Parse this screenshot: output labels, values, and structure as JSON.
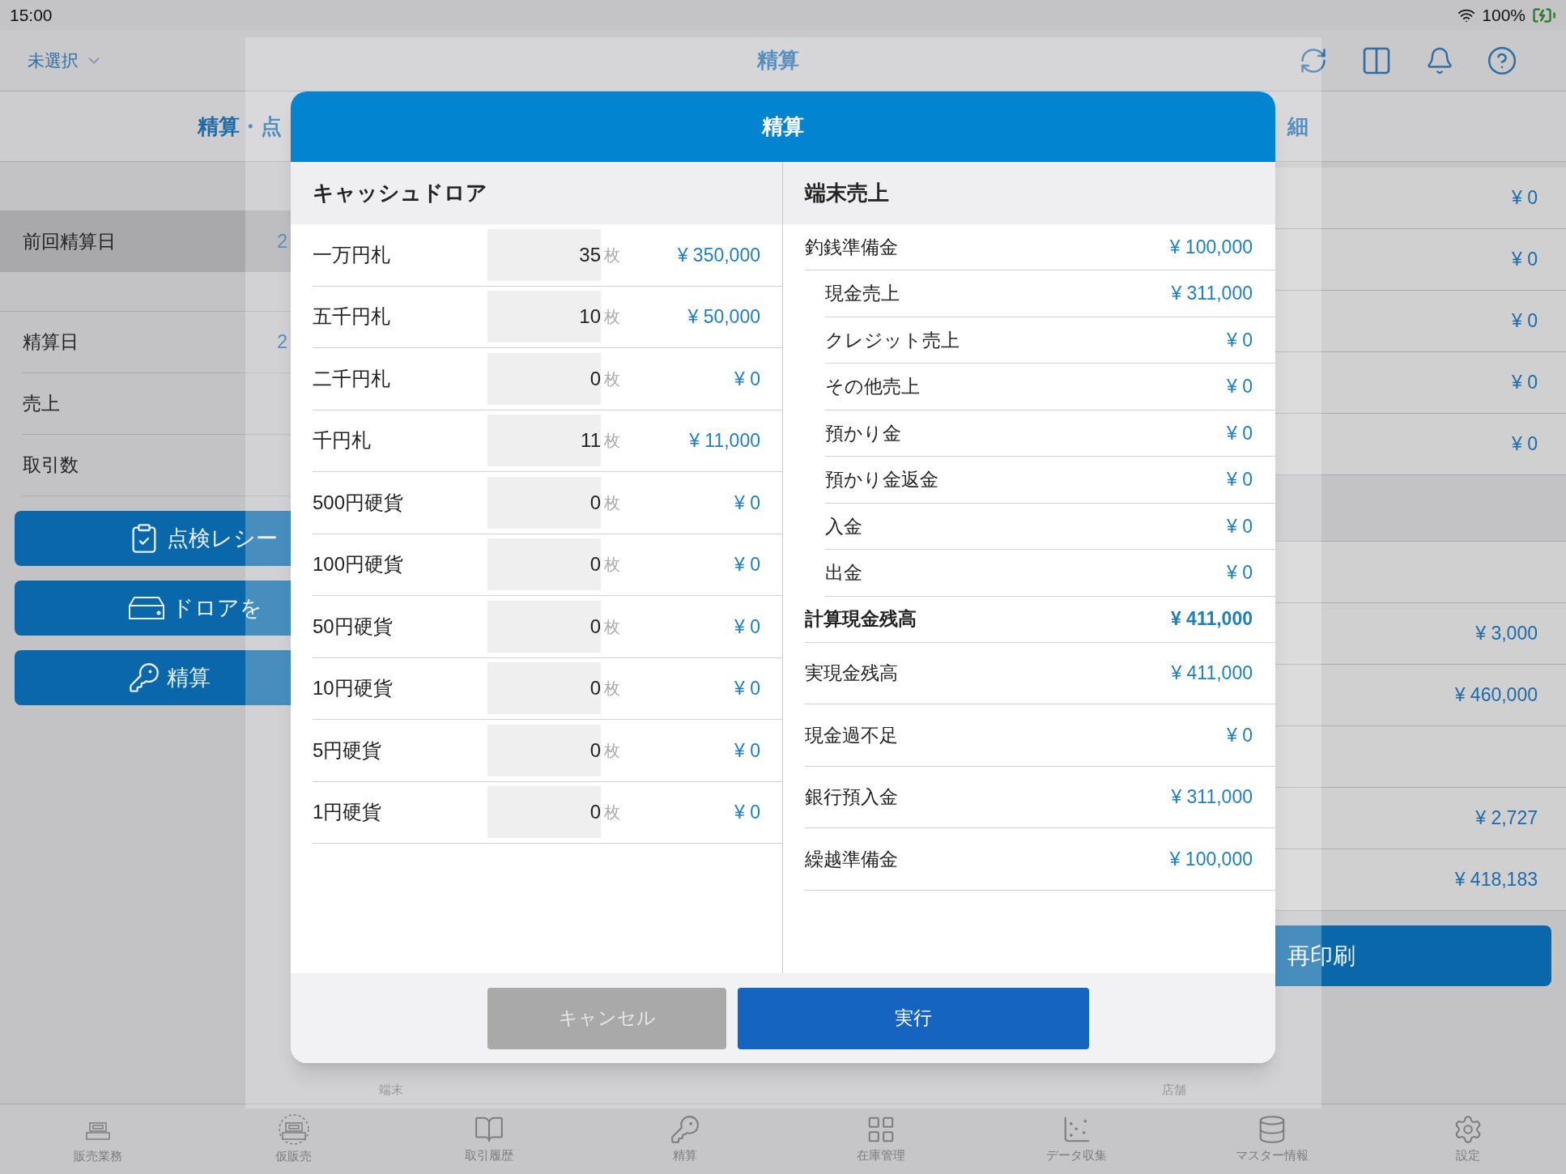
{
  "status_bar": {
    "time": "15:00",
    "battery": "100%"
  },
  "nav_bar": {
    "store_picker": "未選択",
    "title": "精算"
  },
  "background": {
    "header": {
      "left": "精算・点",
      "right": "細"
    },
    "left_panel": {
      "rows": [
        {
          "kind": "header",
          "label": "前回精算日",
          "value": "2"
        },
        {
          "kind": "spacer"
        },
        {
          "kind": "row",
          "label": "精算日",
          "value": "2"
        },
        {
          "kind": "row",
          "label": "売上"
        },
        {
          "kind": "row",
          "label": "取引数"
        }
      ],
      "buttons": [
        {
          "label": "点検レシー"
        },
        {
          "label": "ドロアを"
        },
        {
          "label": "精算"
        }
      ]
    },
    "right_rows": [
      {
        "kind": "row",
        "value": "¥ 0"
      },
      {
        "kind": "row",
        "value": "¥ 0"
      },
      {
        "kind": "row",
        "value": "¥ 0"
      },
      {
        "kind": "row",
        "value": "¥ 0"
      },
      {
        "kind": "row",
        "value": "¥ 0"
      },
      {
        "kind": "band"
      },
      {
        "kind": "row"
      },
      {
        "kind": "row",
        "value": "¥ 3,000"
      },
      {
        "kind": "row",
        "value": "¥ 460,000"
      },
      {
        "kind": "row"
      },
      {
        "kind": "row",
        "value": "¥ 2,727"
      },
      {
        "kind": "row",
        "value": "¥ 418,183"
      }
    ],
    "reprint_button": "再印刷"
  },
  "sheet_footer": [
    "端末",
    "店舗"
  ],
  "dialog": {
    "title": "精算",
    "cash_drawer": {
      "title": "キャッシュドロア",
      "rows": [
        {
          "label": "一万円札",
          "count": "35",
          "unit": "枚",
          "amount": "¥ 350,000"
        },
        {
          "label": "五千円札",
          "count": "10",
          "unit": "枚",
          "amount": "¥ 50,000"
        },
        {
          "label": "二千円札",
          "count": "0",
          "unit": "枚",
          "amount": "¥ 0"
        },
        {
          "label": "千円札",
          "count": "11",
          "unit": "枚",
          "amount": "¥ 11,000"
        },
        {
          "label": "500円硬貨",
          "count": "0",
          "unit": "枚",
          "amount": "¥ 0"
        },
        {
          "label": "100円硬貨",
          "count": "0",
          "unit": "枚",
          "amount": "¥ 0"
        },
        {
          "label": "50円硬貨",
          "count": "0",
          "unit": "枚",
          "amount": "¥ 0"
        },
        {
          "label": "10円硬貨",
          "count": "0",
          "unit": "枚",
          "amount": "¥ 0"
        },
        {
          "label": "5円硬貨",
          "count": "0",
          "unit": "枚",
          "amount": "¥ 0"
        },
        {
          "label": "1円硬貨",
          "count": "0",
          "unit": "枚",
          "amount": "¥ 0"
        }
      ]
    },
    "terminal_sales": {
      "title": "端末売上",
      "rows": [
        {
          "kind": "main",
          "label": "釣銭準備金",
          "value": "¥ 100,000"
        },
        {
          "kind": "sub",
          "label": "現金売上",
          "value": "¥ 311,000"
        },
        {
          "kind": "sub",
          "label": "クレジット売上",
          "value": "¥ 0"
        },
        {
          "kind": "sub",
          "label": "その他売上",
          "value": "¥ 0"
        },
        {
          "kind": "sub",
          "label": "預かり金",
          "value": "¥ 0"
        },
        {
          "kind": "sub",
          "label": "預かり金返金",
          "value": "¥ 0"
        },
        {
          "kind": "sub",
          "label": "入金",
          "value": "¥ 0"
        },
        {
          "kind": "sub",
          "label": "出金",
          "value": "¥ 0"
        },
        {
          "kind": "total",
          "label": "計算現金残高",
          "value": "¥ 411,000"
        },
        {
          "kind": "large",
          "label": "実現金残高",
          "value": "¥ 411,000"
        },
        {
          "kind": "large",
          "label": "現金過不足",
          "value": "¥ 0"
        },
        {
          "kind": "large",
          "label": "銀行預入金",
          "value": "¥ 311,000"
        },
        {
          "kind": "large",
          "label": "繰越準備金",
          "value": "¥ 100,000"
        }
      ]
    },
    "buttons": [
      {
        "kind": "cancel",
        "label": "キャンセル"
      },
      {
        "kind": "primary",
        "label": "実行"
      }
    ]
  },
  "tab_bar": [
    {
      "label": "販売業務"
    },
    {
      "label": "仮販売"
    },
    {
      "label": "取引履歴"
    },
    {
      "label": "精算"
    },
    {
      "label": "在庫管理"
    },
    {
      "label": "データ収集"
    },
    {
      "label": "マスター情報"
    },
    {
      "label": "設定"
    }
  ]
}
